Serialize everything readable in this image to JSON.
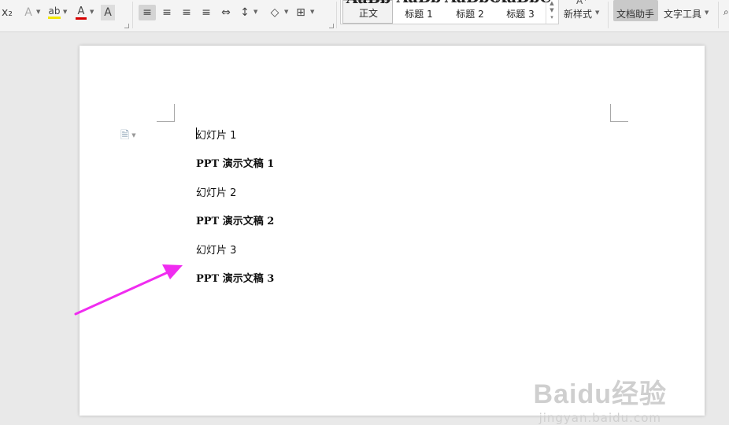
{
  "toolbar": {
    "icons": {
      "subscript": "x₂",
      "text_effects": "A",
      "highlight": "ab",
      "font_color": "A",
      "char_shading": "A",
      "align_left": "≡",
      "align_center": "≡",
      "align_right": "≡",
      "justify": "≡",
      "distributed": "⇔",
      "line_spacing": "↕",
      "shading": "◇",
      "borders": "⊞"
    },
    "colors": {
      "highlight_bar": "#f2e600",
      "font_color_bar": "#d60000",
      "accent": "#c9c9c9"
    },
    "styles": [
      {
        "label": "正文",
        "preview": "AaBb"
      },
      {
        "label": "标题 1",
        "preview": "AaBb"
      },
      {
        "label": "标题 2",
        "preview": "AaBbC"
      },
      {
        "label": "标题 3",
        "preview": "AaBbC"
      }
    ],
    "new_style_label": "新样式",
    "doc_assistant_label": "文档助手",
    "text_tools_label": "文字工具"
  },
  "document": {
    "lines": [
      {
        "text": "幻灯片 1",
        "bold": false
      },
      {
        "text": "PPT  演示文稿  1",
        "bold": true
      },
      {
        "text": "幻灯片 2",
        "bold": false
      },
      {
        "text": "PPT  演示文稿  2",
        "bold": true
      },
      {
        "text": "幻灯片 3",
        "bold": false
      },
      {
        "text": "PPT  演示文稿  3",
        "bold": true
      }
    ]
  },
  "annotation": {
    "arrow_color": "#f02cf0"
  },
  "watermark": {
    "logo": "Baidu经验",
    "url": "jingyan.baidu.com"
  }
}
